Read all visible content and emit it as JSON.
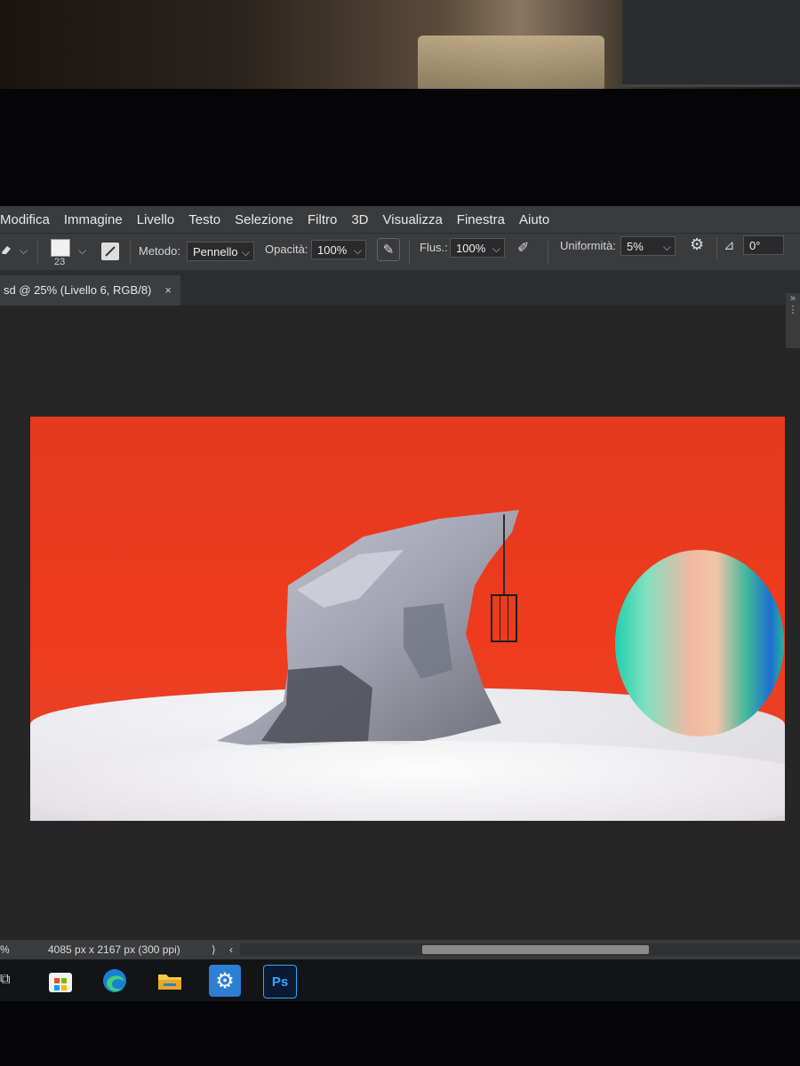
{
  "menubar": {
    "items": [
      "Modifica",
      "Immagine",
      "Livello",
      "Testo",
      "Selezione",
      "Filtro",
      "3D",
      "Visualizza",
      "Finestra",
      "Aiuto"
    ]
  },
  "options": {
    "brush_size": "23",
    "method_label": "Metodo:",
    "method_value": "Pennello",
    "opacity_label": "Opacità:",
    "opacity_value": "100%",
    "flow_label": "Flus.:",
    "flow_value": "100%",
    "uniformity_label": "Uniformità:",
    "uniformity_value": "5%",
    "angle_value": "0°"
  },
  "document": {
    "tab_title": "sd @ 25% (Livello 6, RGB/8)",
    "close_glyph": "×",
    "canvas_background": "#ee3b1d"
  },
  "status": {
    "zoom_fragment": "%",
    "doc_info": "4085 px x 2167 px (300 ppi)",
    "expand_glyph": "⟩",
    "scroll_left_glyph": "‹"
  },
  "right_panel": {
    "collapse_glyph": "»"
  },
  "taskbar": {
    "apps": [
      {
        "name": "Microsoft Store",
        "icon": "store-icon"
      },
      {
        "name": "Microsoft Edge",
        "icon": "edge-icon"
      },
      {
        "name": "Esplora file",
        "icon": "folder-icon"
      },
      {
        "name": "Impostazioni",
        "icon": "settings-gear-icon"
      },
      {
        "name": "Photoshop",
        "icon": "ps-icon",
        "label": "Ps",
        "active": true
      }
    ]
  }
}
